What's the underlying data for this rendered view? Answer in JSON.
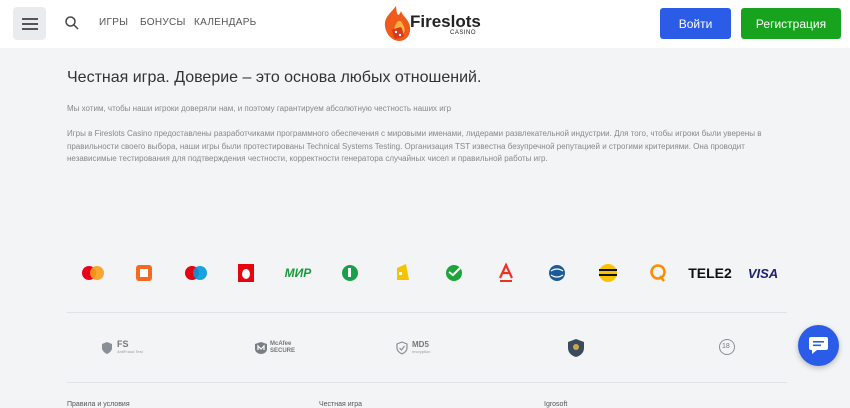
{
  "header": {
    "nav": [
      "ИГРЫ",
      "БОНУСЫ",
      "КАЛЕНДАРЬ"
    ],
    "logo_text": "Fireslots",
    "logo_sub": "CASINO",
    "login_label": "Войти",
    "register_label": "Регистрация"
  },
  "content": {
    "title": "Честная игра. Доверие – это основа любых отношений.",
    "para1": "Мы хотим, чтобы наши игроки доверяли нам, и поэтому гарантируем абсолютную честность наших игр",
    "para2": "Игры в Fireslots Casino предоставлены разработчиками программного обеспечения с мировыми именами, лидерами развлекательной индустрии. Для того, чтобы игроки были уверены в правильности своего выбора, наши игры были протестированы Technical Systems Testing. Организация TST известна безупречной репутацией и строгими критериями. Она проводит независимые тестирования для подтверждения честности, корректности генератора случайных чисел и правильной работы игр."
  },
  "payments": {
    "mir": "МИР",
    "tele2": "TELE2",
    "visa": "VISA"
  },
  "trust": {
    "fs": "FS",
    "fs_sub": "AntiFraud Test",
    "mcafee": "McAfee",
    "mcafee_sub": "SECURE",
    "md5": "MD5",
    "md5_sub": "encryption",
    "age": "18"
  },
  "footer": {
    "links": [
      "Правила и условия",
      "Честная игра",
      "Igrosoft"
    ]
  },
  "colors": {
    "primary": "#2a5ce8",
    "success": "#18a31f"
  }
}
